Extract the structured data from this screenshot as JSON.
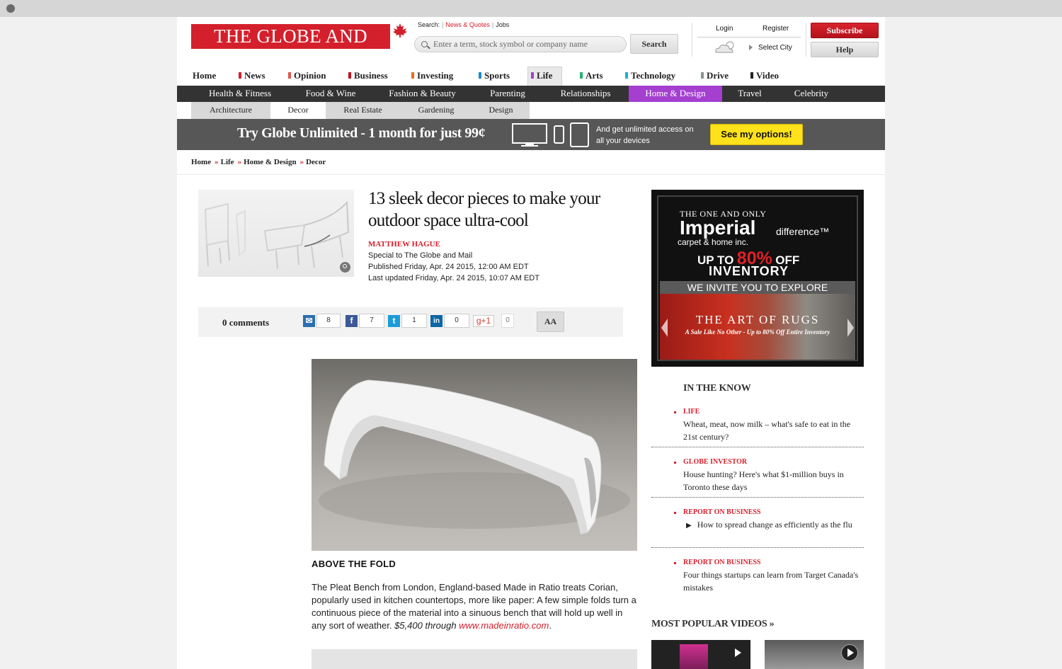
{
  "brand": {
    "logo": "THE GLOBE AND MAIL",
    "brand_red": "#d4202c",
    "life_purple": "#a43fd0"
  },
  "search": {
    "label": "Search:",
    "links": [
      "News & Quotes",
      "Jobs"
    ],
    "placeholder": "Enter a term, stock symbol or company name",
    "button": "Search"
  },
  "account": {
    "login": "Login",
    "register": "Register",
    "select_city": "Select City",
    "subscribe": "Subscribe",
    "help": "Help"
  },
  "nav": {
    "items": [
      {
        "label": "Home",
        "color": ""
      },
      {
        "label": "News",
        "color": "#d4202c"
      },
      {
        "label": "Opinion",
        "color": "#e2574c"
      },
      {
        "label": "Business",
        "color": "#c0131d"
      },
      {
        "label": "Investing",
        "color": "#f26b1d"
      },
      {
        "label": "Sports",
        "color": "#1a8bc9"
      },
      {
        "label": "Life",
        "color": "#a43fd0"
      },
      {
        "label": "Arts",
        "color": "#23b36e"
      },
      {
        "label": "Technology",
        "color": "#1cb0c9"
      },
      {
        "label": "Drive",
        "color": "#8a9296"
      },
      {
        "label": "Video",
        "color": "#222222"
      }
    ]
  },
  "subnav": {
    "items": [
      "Health & Fitness",
      "Food & Wine",
      "Fashion & Beauty",
      "Parenting",
      "Relationships",
      "Home & Design",
      "Travel",
      "Celebrity"
    ],
    "active": "Home & Design"
  },
  "subsubnav": {
    "items": [
      "Architecture",
      "Decor",
      "Real Estate",
      "Gardening",
      "Design"
    ],
    "active": "Decor"
  },
  "promo": {
    "headline": "Try Globe Unlimited - 1 month for just 99¢",
    "subtext": "And get unlimited access on all your devices",
    "button": "See my options!"
  },
  "breadcrumb": [
    "Home",
    "Life",
    "Home & Design",
    "Decor"
  ],
  "article": {
    "headline": "13 sleek decor pieces to make your outdoor space ultra-cool",
    "author": "MATTHEW HAGUE",
    "byline": "Special to The Globe and Mail",
    "published": "Published Friday, Apr. 24 2015, 12:00 AM EDT",
    "updated": "Last updated Friday, Apr. 24 2015, 10:07 AM EDT",
    "comments": "0 comments",
    "caption": "ABOVE THE FOLD",
    "body": "The Pleat Bench from London, England-based Made in Ratio treats Corian, popularly used in kitchen countertops, more like paper: A few simple folds turn a continuous piece of the material into a sinuous bench that will hold up well in any sort of weather. ",
    "price": "$5,400 through ",
    "link": "www.madeinratio.com",
    "link_end": "."
  },
  "share": {
    "counts": [
      "8",
      "7",
      "1",
      "0",
      "0"
    ],
    "gplus": "g+1",
    "text_size": "AA"
  },
  "ad": {
    "line1": "THE ONE AND ONLY",
    "brand": "Imperial",
    "difference": "difference™",
    "sub": "carpet & home inc.",
    "offer_pre": "UP TO",
    "offer_pct": "80%",
    "offer_post": "OFF",
    "inventory": "INVENTORY",
    "invite": "WE INVITE YOU TO EXPLORE",
    "art": "THE ART OF RUGS",
    "sale": "A Sale Like No Other - Up to 80% Off Entire Inventory"
  },
  "in_the_know": {
    "title": "IN THE KNOW",
    "items": [
      {
        "category": "LIFE",
        "text": "Wheat, meat, now milk – what's safe to eat in the 21st century?"
      },
      {
        "category": "GLOBE INVESTOR",
        "text": "House hunting? Here's what $1-million buys in Toronto these days"
      },
      {
        "category": "REPORT ON BUSINESS",
        "text": "How to spread change as efficiently as the flu"
      },
      {
        "category": "REPORT ON BUSINESS",
        "text": "Four things startups can learn from Target Canada's mistakes"
      }
    ]
  },
  "popular_videos": {
    "title": "MOST POPULAR VIDEOS »"
  }
}
